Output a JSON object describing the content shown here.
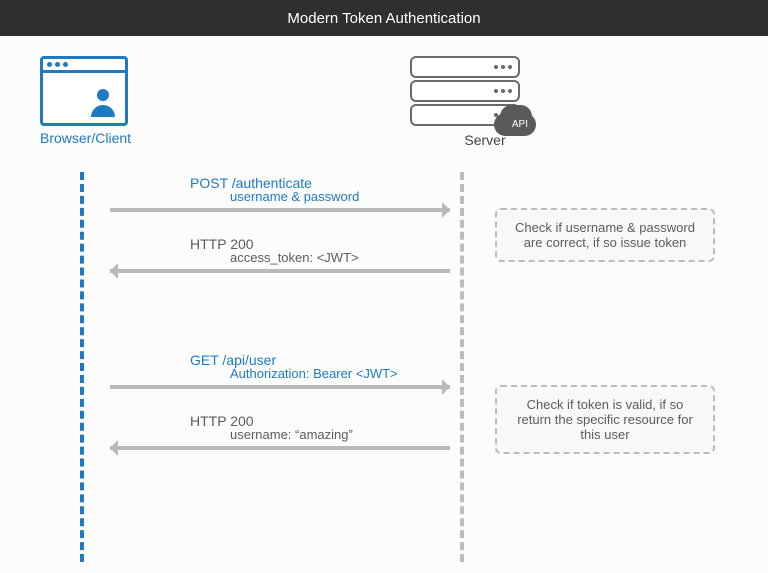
{
  "title": "Modern Token Authentication",
  "actors": {
    "client": "Browser/Client",
    "server": "Server",
    "api_badge": "API"
  },
  "flows": [
    {
      "request": {
        "line": "POST /authenticate",
        "detail": "username & password"
      },
      "response": {
        "line": "HTTP 200",
        "detail": "access_token: <JWT>"
      },
      "note": "Check if username & password are correct, if so issue token"
    },
    {
      "request": {
        "line": "GET /api/user",
        "detail": "Authorization: Bearer <JWT>"
      },
      "response": {
        "line": "HTTP 200",
        "detail": "username: “amazing”"
      },
      "note": "Check if token is valid, if so return the specific resource for this user"
    }
  ]
}
